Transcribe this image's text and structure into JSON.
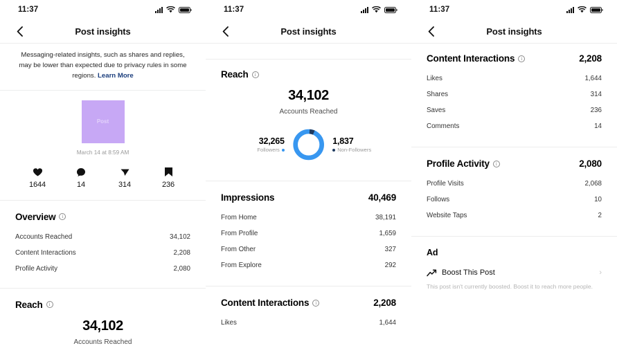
{
  "colors": {
    "followers_blue": "#3897f0",
    "non_followers_navy": "#1f3a5f",
    "link_blue": "#1a3d7c",
    "post_thumb_purple": "#c7a8f5"
  },
  "status_bar": {
    "time": "11:37",
    "signal_icon": "signal-bars-icon",
    "wifi_icon": "wifi-icon",
    "battery_icon": "battery-icon"
  },
  "nav": {
    "title": "Post insights",
    "back_icon": "back-chevron-icon"
  },
  "screen1": {
    "banner": {
      "text": "Messaging-related insights, such as shares and replies, may be lower than expected due to privacy rules in some regions. ",
      "link": "Learn More"
    },
    "post": {
      "thumb_label": "Post",
      "date": "March 14 at 8:59 AM"
    },
    "metrics": [
      {
        "icon": "heart-icon",
        "value": "1644"
      },
      {
        "icon": "comment-icon",
        "value": "14"
      },
      {
        "icon": "share-icon",
        "value": "314"
      },
      {
        "icon": "bookmark-icon",
        "value": "236"
      }
    ],
    "overview": {
      "title": "Overview",
      "rows": [
        {
          "label": "Accounts Reached",
          "value": "34,102"
        },
        {
          "label": "Content Interactions",
          "value": "2,208"
        },
        {
          "label": "Profile Activity",
          "value": "2,080"
        }
      ]
    },
    "reach": {
      "title": "Reach",
      "big_value": "34,102",
      "big_sub": "Accounts Reached"
    }
  },
  "screen2": {
    "reach": {
      "title": "Reach",
      "big_value": "34,102",
      "big_sub": "Accounts Reached",
      "followers": {
        "value": "32,265",
        "label": "Followers"
      },
      "non_followers": {
        "value": "1,837",
        "label": "Non-Followers"
      }
    },
    "impressions": {
      "title": "Impressions",
      "total": "40,469",
      "rows": [
        {
          "label": "From Home",
          "value": "38,191"
        },
        {
          "label": "From Profile",
          "value": "1,659"
        },
        {
          "label": "From Other",
          "value": "327"
        },
        {
          "label": "From Explore",
          "value": "292"
        }
      ]
    },
    "content_interactions": {
      "title": "Content Interactions",
      "total": "2,208",
      "rows": [
        {
          "label": "Likes",
          "value": "1,644"
        }
      ]
    }
  },
  "screen3": {
    "content_interactions": {
      "title": "Content Interactions",
      "total": "2,208",
      "rows": [
        {
          "label": "Likes",
          "value": "1,644"
        },
        {
          "label": "Shares",
          "value": "314"
        },
        {
          "label": "Saves",
          "value": "236"
        },
        {
          "label": "Comments",
          "value": "14"
        }
      ]
    },
    "profile_activity": {
      "title": "Profile Activity",
      "total": "2,080",
      "rows": [
        {
          "label": "Profile Visits",
          "value": "2,068"
        },
        {
          "label": "Follows",
          "value": "10"
        },
        {
          "label": "Website Taps",
          "value": "2"
        }
      ]
    },
    "ad": {
      "title": "Ad",
      "boost_label": "Boost This Post",
      "boost_icon": "trending-up-icon",
      "chevron": "›",
      "note": "This post isn't currently boosted. Boost it to reach more people."
    }
  },
  "chart_data": {
    "type": "pie",
    "title": "Reach breakdown",
    "categories": [
      "Followers",
      "Non-Followers"
    ],
    "values": [
      32265,
      1837
    ],
    "colors": [
      "#3897f0",
      "#1f3a5f"
    ],
    "total": 34102,
    "legend": "sides"
  }
}
